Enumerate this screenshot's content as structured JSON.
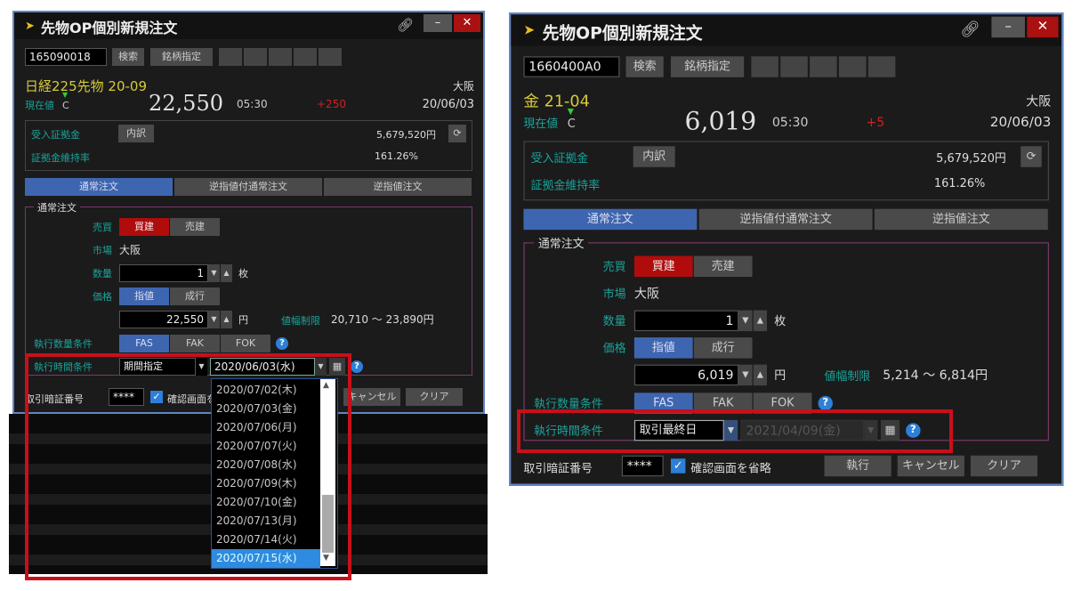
{
  "windows": [
    {
      "title": "先物OP個別新規注文",
      "code": "165090018",
      "search_label": "検索",
      "symbol_label": "銘柄指定",
      "name": "日経225先物 20-09",
      "exchange": "大阪",
      "current_label": "現在値",
      "c_mark": "C",
      "price": "22,550",
      "time": "05:30",
      "change": "+250",
      "date": "20/06/03",
      "margin_label": "受入証拠金",
      "breakdown_label": "内訳",
      "margin_value": "5,679,520円",
      "ratio_label": "証拠金維持率",
      "ratio_value": "161.26%",
      "tabs": [
        "通常注文",
        "逆指値付通常注文",
        "逆指値注文"
      ],
      "group_title": "通常注文",
      "side_label": "売買",
      "buy": "買建",
      "sell": "売建",
      "market_label": "市場",
      "market": "大阪",
      "qty_label": "数量",
      "qty": "1",
      "qty_unit": "枚",
      "price_label": "価格",
      "limit": "指値",
      "market_order": "成行",
      "price_value": "22,550",
      "price_unit": "円",
      "range_label": "値幅制限",
      "range": "20,710 ～ 23,890円",
      "exec_qty_label": "執行数量条件",
      "fas": "FAS",
      "fak": "FAK",
      "fok": "FOK",
      "exec_time_label": "執行時間条件",
      "time_cond": "期間指定",
      "expiry_date": "2020/06/03(水)",
      "date_disabled": false,
      "pin_label": "取引暗証番号",
      "pin": "****",
      "skip_confirm_label": "確認画面を省略",
      "cancel": "キャンセル",
      "clear": "クリア"
    },
    {
      "title": "先物OP個別新規注文",
      "code": "1660400A0",
      "search_label": "検索",
      "symbol_label": "銘柄指定",
      "name": "金 21-04",
      "exchange": "大阪",
      "current_label": "現在値",
      "c_mark": "C",
      "price": "6,019",
      "time": "05:30",
      "change": "+5",
      "date": "20/06/03",
      "margin_label": "受入証拠金",
      "breakdown_label": "内訳",
      "margin_value": "5,679,520円",
      "ratio_label": "証拠金維持率",
      "ratio_value": "161.26%",
      "tabs": [
        "通常注文",
        "逆指値付通常注文",
        "逆指値注文"
      ],
      "group_title": "通常注文",
      "side_label": "売買",
      "buy": "買建",
      "sell": "売建",
      "market_label": "市場",
      "market": "大阪",
      "qty_label": "数量",
      "qty": "1",
      "qty_unit": "枚",
      "price_label": "価格",
      "limit": "指値",
      "market_order": "成行",
      "price_value": "6,019",
      "price_unit": "円",
      "range_label": "値幅制限",
      "range": "5,214 ～ 6,814円",
      "exec_qty_label": "執行数量条件",
      "fas": "FAS",
      "fak": "FAK",
      "fok": "FOK",
      "exec_time_label": "執行時間条件",
      "time_cond": "取引最終日",
      "expiry_date": "2021/04/09(金)",
      "date_disabled": true,
      "pin_label": "取引暗証番号",
      "pin": "****",
      "skip_confirm_label": "確認画面を省略",
      "execute": "執行",
      "cancel": "キャンセル",
      "clear": "クリア"
    }
  ],
  "date_dropdown": {
    "options": [
      "2020/07/02(木)",
      "2020/07/03(金)",
      "2020/07/06(月)",
      "2020/07/07(火)",
      "2020/07/08(水)",
      "2020/07/09(木)",
      "2020/07/10(金)",
      "2020/07/13(月)",
      "2020/07/14(火)",
      "2020/07/15(水)"
    ],
    "selected": "2020/07/15(水)"
  },
  "colors": {
    "highlight": "#c8101a",
    "accent": "#3e66b0",
    "label": "#1aa39a",
    "symbol": "#d6c93a",
    "change": "#d02020"
  }
}
